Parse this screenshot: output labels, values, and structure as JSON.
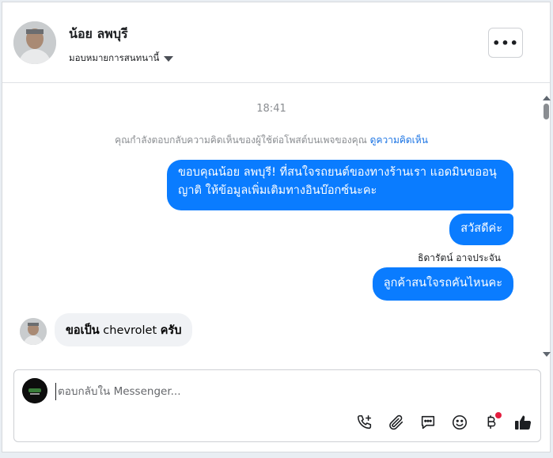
{
  "header": {
    "contact_name": "น้อย ลพบุรี",
    "assign_label": "มอบหมายการสนทนานี้",
    "more_label": "•••"
  },
  "conversation": {
    "timestamp": "18:41",
    "notice_text": "คุณกำลังตอบกลับความคิดเห็นของผู้ใช้ต่อโพสต์บนเพจของคุณ",
    "notice_link": "ดูความคิดเห็น",
    "messages": [
      {
        "direction": "out",
        "text": "ขอบคุณน้อย ลพบุรี! ที่สนใจรถยนต์ของทางร้านเรา แอดมินขออนุญาติ ให้ข้อมูลเพิ่มเติมทางอินบ๊อกซ์นะคะ"
      },
      {
        "direction": "out",
        "text": "สวัสดีค่ะ"
      },
      {
        "direction": "out",
        "text": "ลูกค้าสนใจรถคันไหนคะ",
        "sender": "ธิดารัตน์ อาจประจัน"
      },
      {
        "direction": "in",
        "bold_part_1": "ขอเป็น",
        "plain_part": " chevrolet ",
        "bold_part_2": "ครับ"
      }
    ]
  },
  "composer": {
    "placeholder": "ตอบกลับใน Messenger...",
    "tools": [
      "phone-plus-icon",
      "paperclip-icon",
      "chat-bubble-icon",
      "smiley-icon",
      "baht-icon",
      "thumbs-up-icon"
    ]
  },
  "colors": {
    "outgoing_bubble": "#0a7cff",
    "incoming_bubble": "#f0f2f5",
    "link": "#1b74e4",
    "notification_dot": "#e41e3f"
  }
}
